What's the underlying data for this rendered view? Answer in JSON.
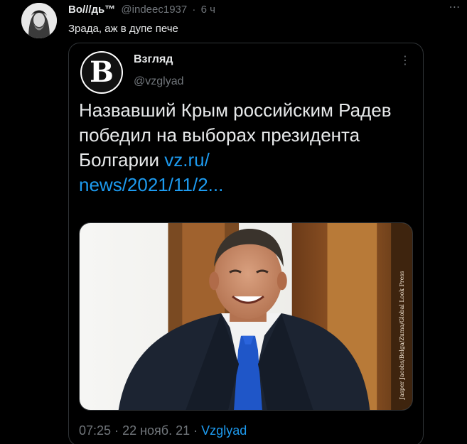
{
  "tweet": {
    "author_name": "Во///дь™",
    "author_handle": "@indeec1937",
    "separator": "·",
    "time": "6 ч",
    "text": "Зрада, аж в дупе пече",
    "more_icon": "more-horizontal-icon"
  },
  "quote": {
    "logo_letter": "В",
    "author_name": "Взгляд",
    "author_handle": "@vzglyad",
    "text": "Назвавший Крым российским Радев победил на выборах президента Болгарии",
    "link_line1": "vz.ru/",
    "link_line2": "news/2021/11/2...",
    "photo_credit": "Jasper Jacobs/Belga/Zuma/Global Look Press",
    "timestamp": "07:25",
    "separator": "·",
    "date": "22 нояб. 21",
    "source": "Vzglyad",
    "more_icon": "more-vertical-icon"
  }
}
